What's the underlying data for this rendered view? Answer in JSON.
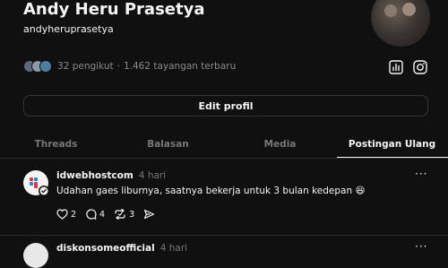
{
  "profile": {
    "name": "Andy Heru Prasetya",
    "handle": "andyheruprasetya",
    "followers_text": "32 pengikut",
    "separator": "·",
    "views_text": "1.462 tayangan terbaru",
    "edit_label": "Edit profil"
  },
  "tabs": [
    {
      "label": "Threads",
      "active": false
    },
    {
      "label": "Balasan",
      "active": false
    },
    {
      "label": "Media",
      "active": false
    },
    {
      "label": "Postingan Ulang",
      "active": true
    }
  ],
  "posts": [
    {
      "username": "idwebhostcom",
      "time": "4 hari",
      "text": "Udahan gaes liburnya, saatnya bekerja untuk 3 bulan kedepan 😆",
      "likes": "2",
      "replies": "4",
      "reposts": "3",
      "more": "···"
    },
    {
      "username": "diskonsomeofficial",
      "time": "4 hari",
      "more": "···"
    }
  ],
  "icons": {
    "insights": "bar-chart-icon",
    "instagram": "instagram-icon"
  },
  "colors": {
    "background": "#101010",
    "text": "#f3f5f7",
    "muted": "#777777",
    "border": "#333638"
  }
}
